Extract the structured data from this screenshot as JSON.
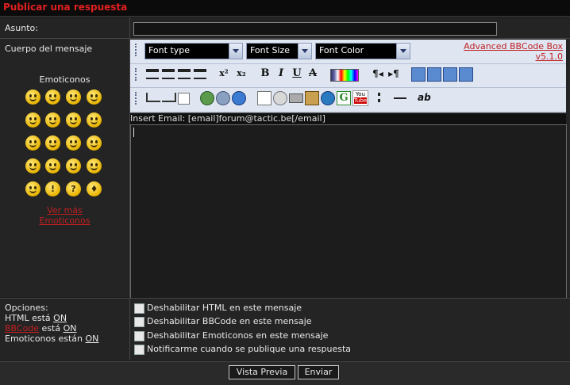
{
  "header": {
    "title": "Publicar una respuesta"
  },
  "subject": {
    "label": "Asunto:",
    "value": ""
  },
  "body": {
    "label": "Cuerpo del mensaje",
    "emoticons_title": "Emoticonos",
    "more_line1": "Ver más",
    "more_line2": "Emoticonos"
  },
  "toolbar": {
    "font_type": "Font type",
    "font_size": "Font Size",
    "font_color": "Font Color",
    "advanced_line1": "Advanced BBCode Box",
    "advanced_line2": "v5.1.0",
    "bold": "B",
    "italic": "I",
    "underline": "U",
    "strike": "A",
    "sup": "x²",
    "sub": "x₂",
    "ab": "ab",
    "youtube_top": "You",
    "youtube_bottom": "Tube",
    "google": "G"
  },
  "hint": "Insert Email: [email]forum@tactic.be[/email]",
  "options": {
    "title": "Opciones:",
    "html_prefix": "HTML está",
    "html_state": "ON",
    "bbcode_link": "BBCode",
    "bbcode_mid": " está",
    "bbcode_state": "ON",
    "emo_prefix": "Emoticonos están",
    "emo_state": "ON",
    "checks": [
      "Deshabilitar HTML en este mensaje",
      "Deshabilitar BBCode en este mensaje",
      "Deshabilitar Emoticonos en este mensaje",
      "Notificarme cuando se publique una respuesta"
    ]
  },
  "buttons": {
    "preview": "Vista Previa",
    "submit": "Enviar"
  }
}
